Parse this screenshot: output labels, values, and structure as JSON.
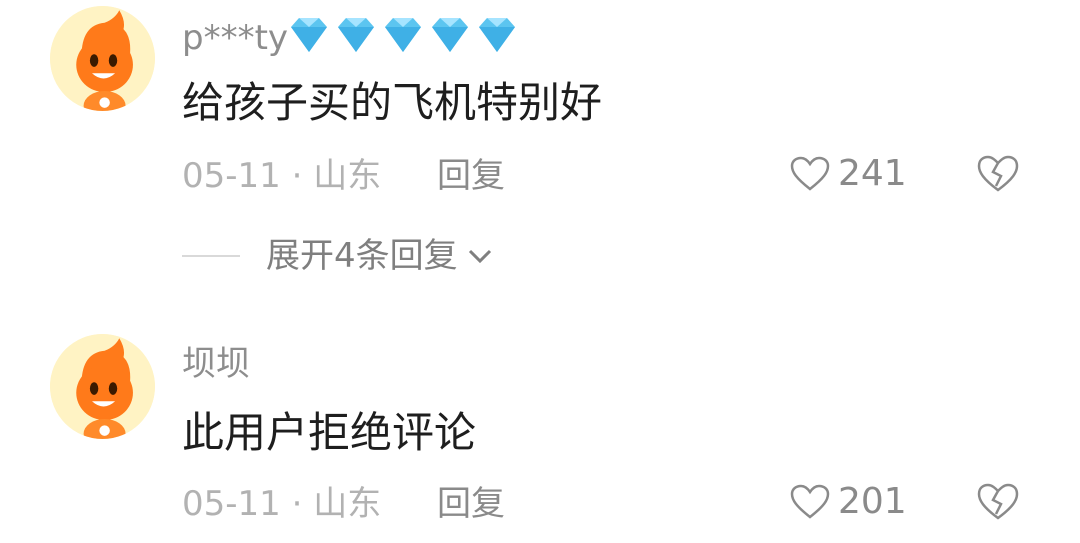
{
  "comments": [
    {
      "username": "p***ty",
      "badges": [
        "diamond-icon",
        "diamond-icon",
        "diamond-icon",
        "diamond-icon",
        "diamond-icon"
      ],
      "text": "给孩子买的飞机特别好",
      "meta": "05-11 · 山东",
      "reply_label": "回复",
      "likes": "241",
      "expand_label": "展开4条回复"
    },
    {
      "username": "坝坝",
      "badges": [],
      "text": "此用户拒绝评论",
      "meta": "05-11 · 山东",
      "reply_label": "回复",
      "likes": "201"
    }
  ],
  "colors": {
    "username": "#8d8d8d",
    "text": "#1e1e1e",
    "meta": "#b2b2b2",
    "diamond": "#5cc5f0",
    "avatar_bg": "#fff3c4",
    "mascot": "#ff7a1a"
  }
}
